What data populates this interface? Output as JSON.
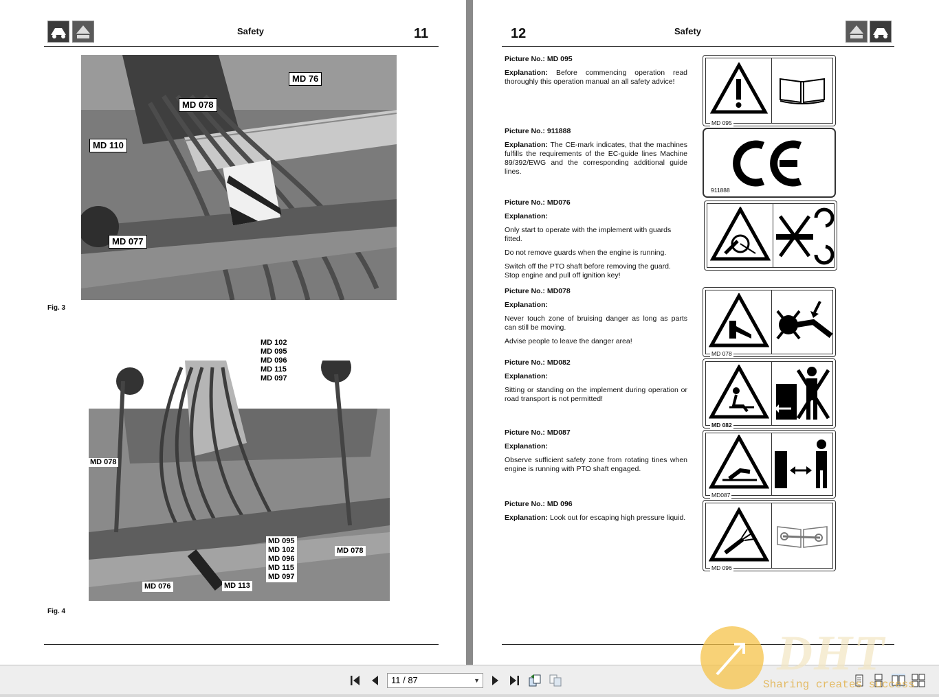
{
  "left_page": {
    "header_title": "Safety",
    "page_number": "11",
    "fig3_label": "Fig. 3",
    "fig4_label": "Fig. 4",
    "fig3_callouts": [
      "MD 76",
      "MD 078",
      "MD 110",
      "MD 077"
    ],
    "fig4_top_labels": [
      "MD 102",
      "MD 095",
      "MD 096",
      "MD 115",
      "MD 097"
    ],
    "fig4_left_label": "MD 078",
    "fig4_box_group": [
      "MD 095",
      "MD 102",
      "MD 096",
      "MD 115",
      "MD 097"
    ],
    "fig4_right_label": "MD 078",
    "fig4_bottom_left": "MD 076",
    "fig4_bottom_mid": "MD 113"
  },
  "right_page": {
    "header_title": "Safety",
    "page_number": "12",
    "entries": [
      {
        "picture_label": "Picture No.:",
        "picture_no": "MD 095",
        "expl_label": "Explanation:",
        "expl_inline": "Before commencing operation read thoroughly this operation manual an all safety advice!",
        "paragraphs": [],
        "sign_code": "MD 095"
      },
      {
        "picture_label": "Picture No.:",
        "picture_no": "911888",
        "expl_label": "Explanation:",
        "expl_inline": "The CE-mark indicates, that the machines fulfills the requirements of the EC-guide lines Machine 89/392/EWG and the corresponding additional guide lines.",
        "paragraphs": [],
        "sign_code": "911888"
      },
      {
        "picture_label": "Picture No.:",
        "picture_no": "MD076",
        "expl_label": "Explanation:",
        "expl_inline": "",
        "paragraphs": [
          "Only start to operate with the implement with guards fitted.",
          "Do not remove guards when the engine is running.",
          "Switch off the PTO shaft before removing the guard. Stop engine and pull off ignition key!"
        ],
        "sign_code": ""
      },
      {
        "picture_label": "Picture No.:",
        "picture_no": "MD078",
        "expl_label": "Explanation:",
        "expl_inline": "",
        "paragraphs": [
          "Never touch zone of bruising danger as long as parts can still be moving.",
          "Advise people to leave the danger area!"
        ],
        "sign_code": "MD 078"
      },
      {
        "picture_label": "Picture No.:",
        "picture_no": "MD082",
        "expl_label": "Explanation:",
        "expl_inline": "",
        "paragraphs": [
          "Sitting or standing on the implement during operation or road transport is not permitted!"
        ],
        "sign_code": "MD 082"
      },
      {
        "picture_label": "Picture No.:",
        "picture_no": "MD087",
        "expl_label": "Explanation:",
        "expl_inline": "",
        "paragraphs": [
          "Observe sufficient safety zone from rotating tines when engine is running with PTO shaft engaged."
        ],
        "sign_code": "MD087"
      },
      {
        "picture_label": "Picture No.:",
        "picture_no": "MD 096",
        "expl_label": "Explanation:",
        "expl_inline": "Look out for escaping high pressure liquid.",
        "paragraphs": [],
        "sign_code": "MD 096"
      }
    ]
  },
  "toolbar": {
    "page_field": "11 / 87",
    "icons": [
      "first-page-icon",
      "previous-page-icon",
      "next-page-icon",
      "last-page-icon",
      "previous-view-icon",
      "next-view-icon",
      "single-page-icon",
      "continuous-page-icon",
      "facing-pages-icon",
      "continuous-facing-icon"
    ]
  },
  "watermark": {
    "text": "Sharing creates success",
    "logo": "DHT"
  }
}
